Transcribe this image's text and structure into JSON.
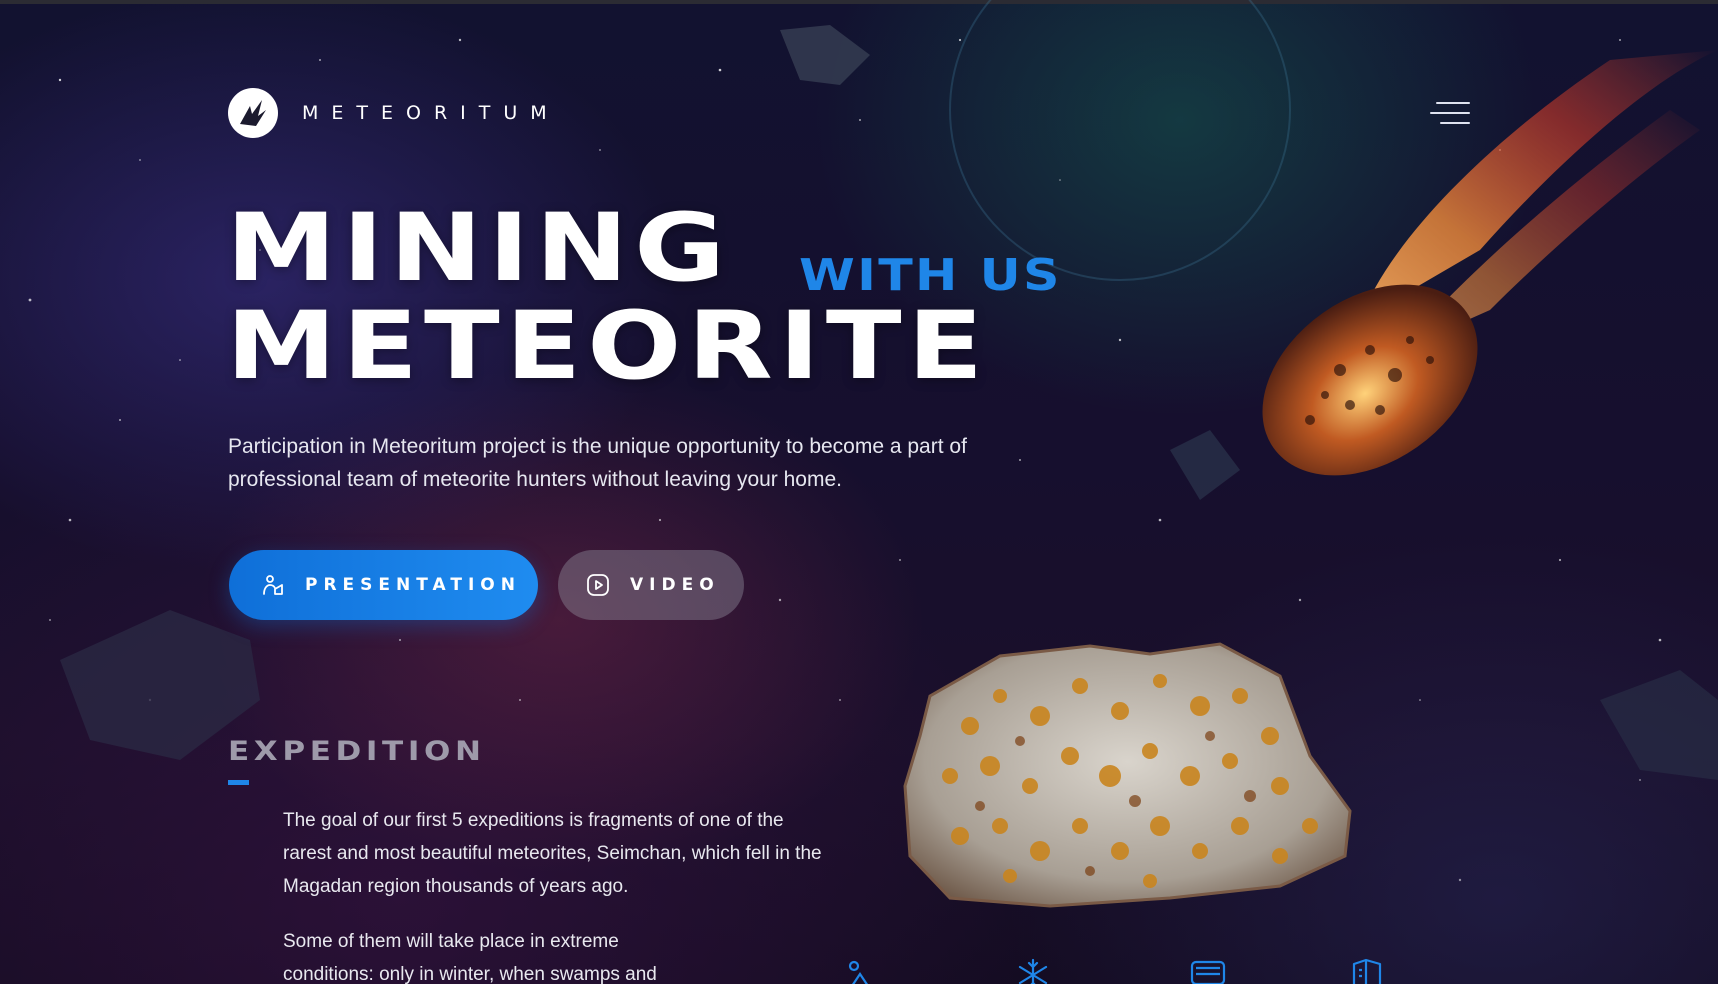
{
  "header": {
    "brand": "METEORITUM",
    "logo_icon": "meteoritum-logo-icon",
    "menu_icon": "hamburger-menu-icon"
  },
  "hero": {
    "title_line1": "MINING",
    "title_line2": "METEORITE",
    "accent": "WITH US",
    "description": "Participation in Meteoritum project is the unique opportunity to become a part of professional team of meteorite hunters without leaving your home.",
    "buttons": {
      "presentation": "PRESENTATION",
      "video": "VIDEO"
    }
  },
  "expedition": {
    "title": "EXPEDITION",
    "paragraph1": "The goal of our first 5 expeditions is fragments of one of the rarest and most beautiful meteorites, Seimchan, which fell in the Magadan region thousands of years ago.",
    "paragraph2": "Some of them will take place in extreme conditions: only in winter, when swamps and"
  },
  "icons": [
    "hiker-icon",
    "snowflake-icon",
    "vehicle-icon",
    "book-icon"
  ],
  "colors": {
    "accent": "#1f86e8",
    "primary_button": "#1a82e8",
    "background": "#140f2a"
  }
}
